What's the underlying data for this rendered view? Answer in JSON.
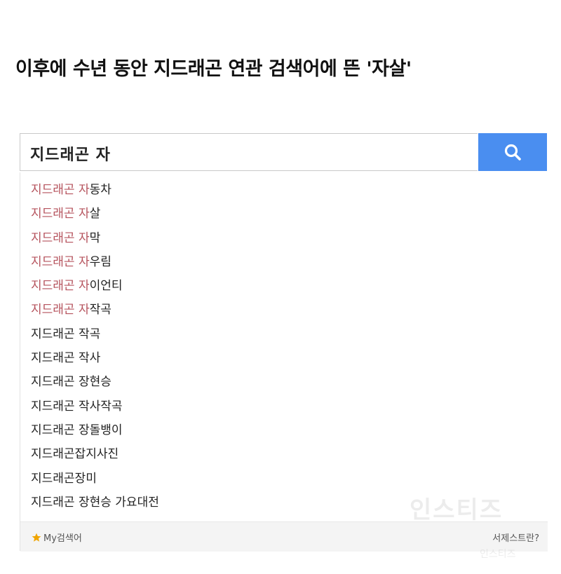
{
  "headline": "이후에 수년 동안 지드래곤 연관 검색어에 뜬 '자살'",
  "search": {
    "query": "지드래곤 자",
    "button_icon": "search-icon",
    "button_color": "#4a8ef0"
  },
  "suggestions": [
    {
      "hl": "지드래곤 자",
      "rest": "동차"
    },
    {
      "hl": "지드래곤 자",
      "rest": "살"
    },
    {
      "hl": "지드래곤 자",
      "rest": "막"
    },
    {
      "hl": "지드래곤 자",
      "rest": "우림"
    },
    {
      "hl": "지드래곤 자",
      "rest": "이언티"
    },
    {
      "hl": "지드래곤 자",
      "rest": "작곡"
    },
    {
      "hl": "",
      "rest": "지드래곤 작곡"
    },
    {
      "hl": "",
      "rest": "지드래곤 작사"
    },
    {
      "hl": "",
      "rest": "지드래곤 장현승"
    },
    {
      "hl": "",
      "rest": "지드래곤 작사작곡"
    },
    {
      "hl": "",
      "rest": "지드래곤 장돌뱅이"
    },
    {
      "hl": "",
      "rest": "지드래곤잡지사진"
    },
    {
      "hl": "",
      "rest": "지드래곤장미"
    },
    {
      "hl": "",
      "rest": "지드래곤 장현승 가요대전"
    }
  ],
  "highlight_color": "#b5525c",
  "footer": {
    "my_search_icon": "star-icon",
    "my_search_label": "My검색어",
    "help_label": "서제스트란?"
  },
  "watermark": {
    "text": "인스티즈",
    "small_text": "인스티즈"
  }
}
